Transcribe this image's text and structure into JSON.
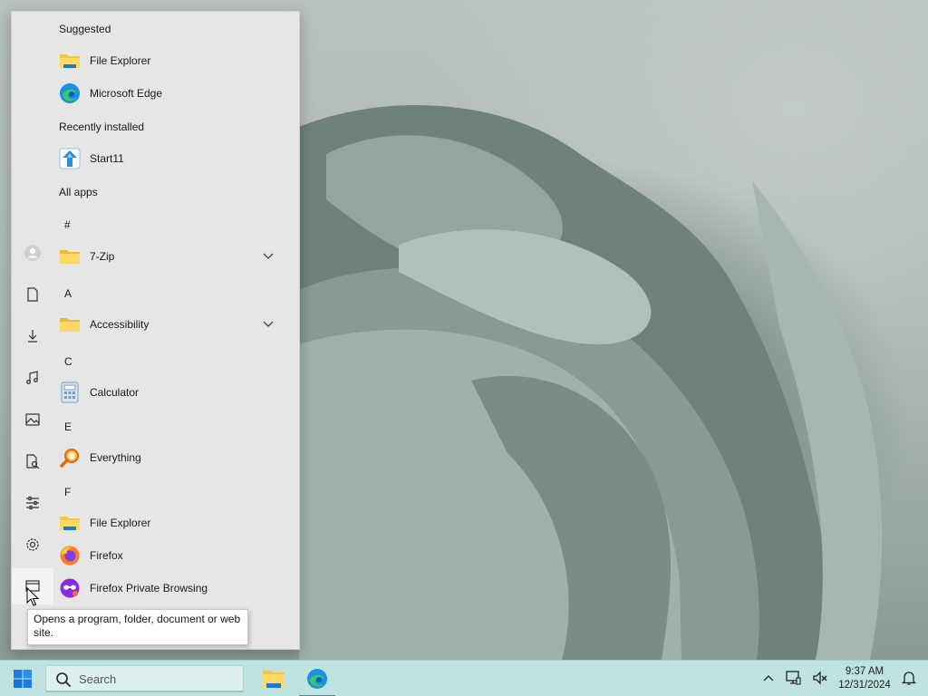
{
  "start_menu": {
    "sections": {
      "suggested": "Suggested",
      "recently_installed": "Recently installed",
      "all_apps": "All apps"
    },
    "suggested": [
      {
        "label": "File Explorer",
        "icon": "folder-icon"
      },
      {
        "label": "Microsoft Edge",
        "icon": "edge-icon"
      }
    ],
    "recent": [
      {
        "label": "Start11",
        "icon": "start11-icon"
      }
    ],
    "letters": [
      "#",
      "A",
      "C",
      "E",
      "F"
    ],
    "apps": [
      {
        "label": "7-Zip",
        "icon": "folder-icon",
        "expandable": true
      },
      {
        "label": "Accessibility",
        "icon": "folder-icon",
        "expandable": true
      },
      {
        "label": "Calculator",
        "icon": "calculator-icon"
      },
      {
        "label": "Everything",
        "icon": "everything-icon"
      },
      {
        "label": "File Explorer",
        "icon": "folder-icon"
      },
      {
        "label": "Firefox",
        "icon": "firefox-icon"
      },
      {
        "label": "Firefox Private Browsing",
        "icon": "firefox-private-icon"
      }
    ],
    "rail": [
      "user-icon",
      "documents-icon",
      "downloads-icon",
      "music-icon",
      "pictures-icon",
      "file-explorer-icon",
      "personalization-icon",
      "settings-icon",
      "run-icon"
    ]
  },
  "tooltip": {
    "text": "Opens a program, folder, document or web site."
  },
  "taskbar": {
    "search_placeholder": "Search",
    "time": "9:37 AM",
    "date": "12/31/2024"
  },
  "colors": {
    "taskbar_bg": "#bfe3e0",
    "menu_bg": "#e6e6e6",
    "accent": "#3a8fd8"
  }
}
